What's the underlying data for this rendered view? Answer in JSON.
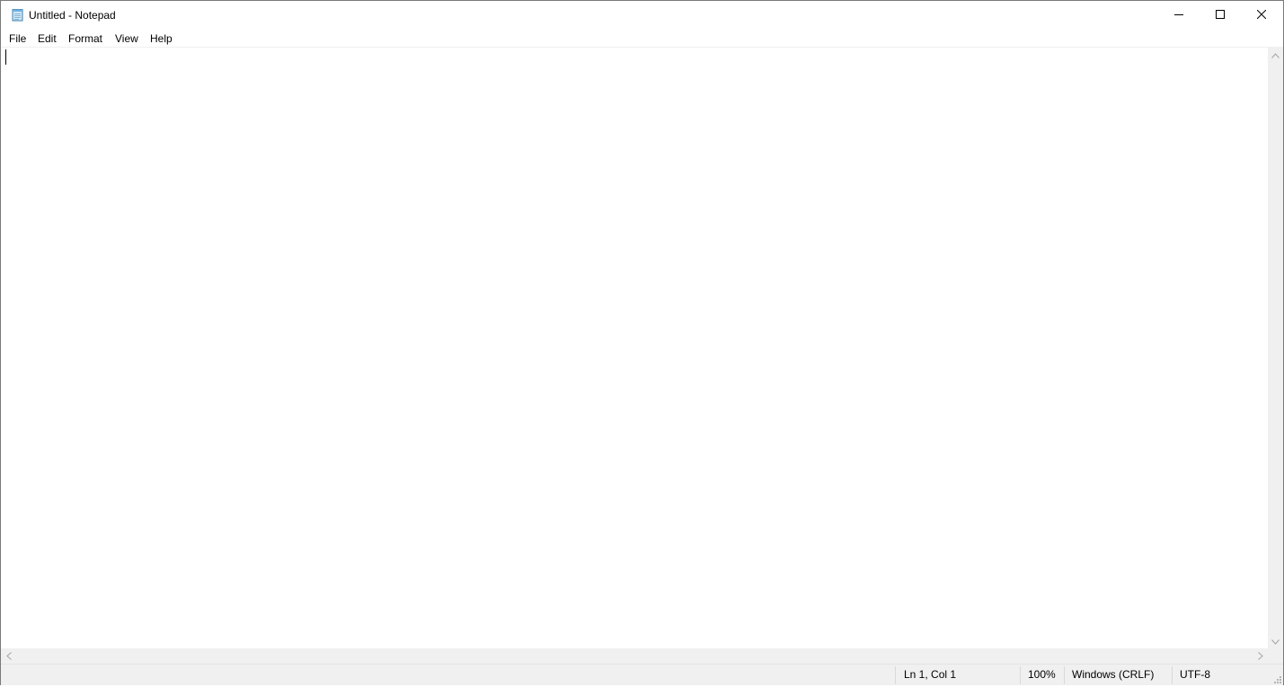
{
  "window": {
    "title": "Untitled - Notepad",
    "icons": {
      "app": "notepad-icon",
      "minimize": "minimize-icon",
      "maximize": "maximize-icon",
      "close": "close-icon"
    }
  },
  "menu": {
    "items": [
      {
        "label": "File"
      },
      {
        "label": "Edit"
      },
      {
        "label": "Format"
      },
      {
        "label": "View"
      },
      {
        "label": "Help"
      }
    ]
  },
  "editor": {
    "content": ""
  },
  "status": {
    "position": "Ln 1, Col 1",
    "zoom": "100%",
    "line_ending": "Windows (CRLF)",
    "encoding": "UTF-8"
  },
  "colors": {
    "window_border": "#7a7a7a",
    "statusbar_bg": "#f0f0f0",
    "scrollbar_bg": "#f0f0f0"
  }
}
